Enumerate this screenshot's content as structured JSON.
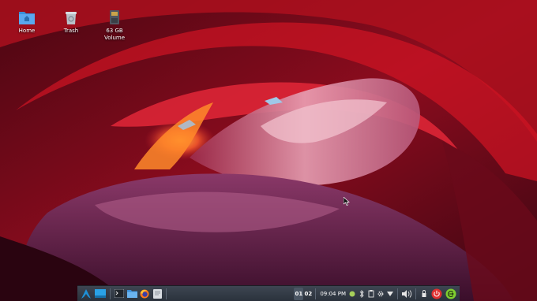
{
  "desktop": {
    "icons": [
      {
        "label": "Home",
        "icon": "folder-home-icon"
      },
      {
        "label": "Trash",
        "icon": "trash-icon"
      },
      {
        "label": "63 GB\nVolume",
        "line1": "63 GB",
        "line2": "Volume",
        "icon": "drive-icon"
      }
    ]
  },
  "taskbar": {
    "workspaces": [
      "01",
      "02"
    ],
    "clock": "09:04 PM",
    "accent": "#1e90d6",
    "power_color": "#e03030",
    "logout_color": "#7fcf2f"
  }
}
